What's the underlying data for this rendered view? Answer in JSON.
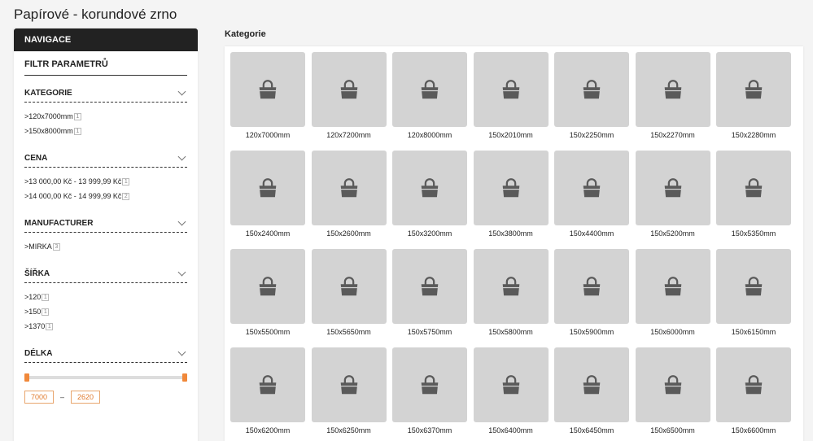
{
  "page": {
    "title": "Papírové - korundové zrno"
  },
  "sidebar": {
    "nav_header": "NAVIGACE",
    "filter_title": "FILTR PARAMETRŮ",
    "groups": [
      {
        "title": "KATEGORIE",
        "items": [
          {
            "label": ">120x7000mm",
            "count": "1"
          },
          {
            "label": ">150x8000mm",
            "count": "1"
          }
        ]
      },
      {
        "title": "CENA",
        "items": [
          {
            "label": ">13 000,00 Kč - 13 999,99 Kč",
            "count": "1"
          },
          {
            "label": ">14 000,00 Kč - 14 999,99 Kč",
            "count": "2"
          }
        ]
      },
      {
        "title": "MANUFACTURER",
        "items": [
          {
            "label": ">MIRKA",
            "count": "3"
          }
        ]
      },
      {
        "title": "ŠÍŘKA",
        "items": [
          {
            "label": ">120",
            "count": "1"
          },
          {
            "label": ">150",
            "count": "1"
          },
          {
            "label": ">1370",
            "count": "1"
          }
        ]
      }
    ],
    "length_filter": {
      "title": "DÉLKA",
      "min_value": "7000",
      "max_value": "2620",
      "separator": "–",
      "min_fraction": 0.0,
      "max_fraction": 1.0
    }
  },
  "main": {
    "section_title": "Kategorie",
    "categories": [
      "120x7000mm",
      "120x7200mm",
      "120x8000mm",
      "150x2010mm",
      "150x2250mm",
      "150x2270mm",
      "150x2280mm",
      "150x2400mm",
      "150x2600mm",
      "150x3200mm",
      "150x3800mm",
      "150x4400mm",
      "150x5200mm",
      "150x5350mm",
      "150x5500mm",
      "150x5650mm",
      "150x5750mm",
      "150x5800mm",
      "150x5900mm",
      "150x6000mm",
      "150x6150mm",
      "150x6200mm",
      "150x6250mm",
      "150x6370mm",
      "150x6400mm",
      "150x6450mm",
      "150x6500mm",
      "150x6600mm"
    ],
    "placeholder_icon": "shopping-bag-icon"
  },
  "colors": {
    "nav_bg": "#222222",
    "accent": "#f0883a",
    "tile_bg": "#d3d3d3",
    "icon": "#5a5a5a"
  }
}
